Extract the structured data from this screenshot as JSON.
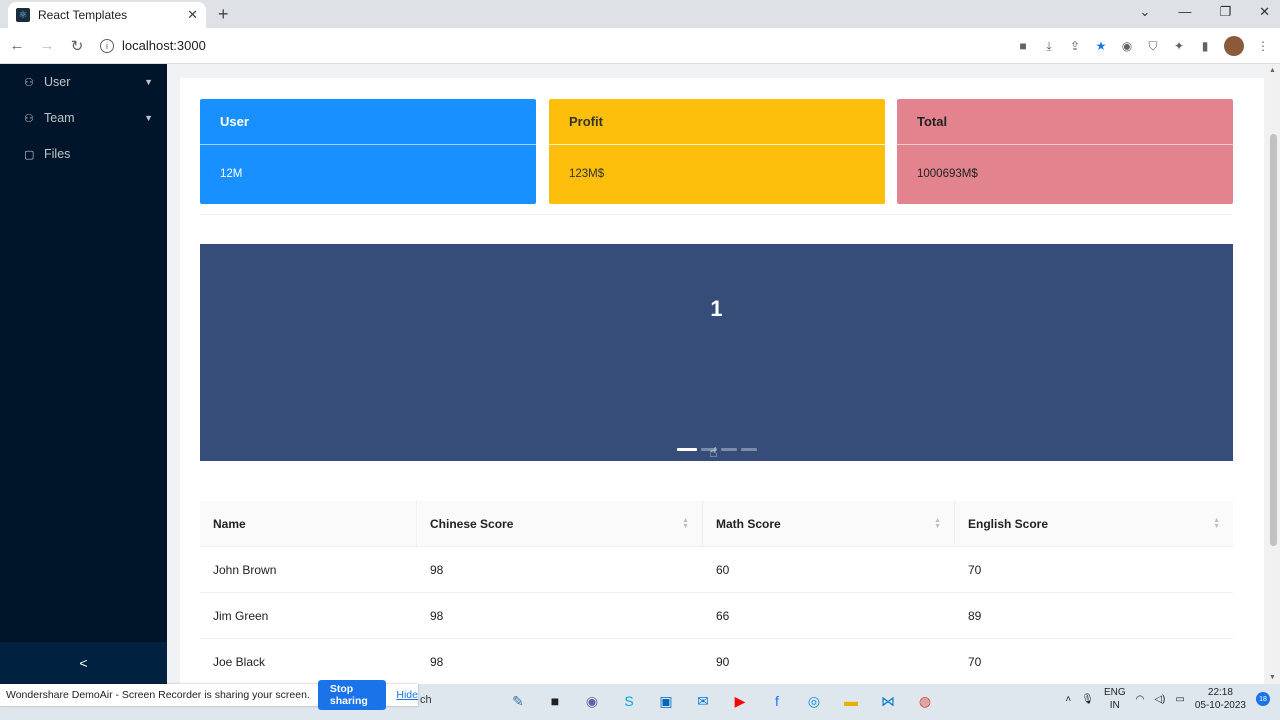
{
  "browser": {
    "tab_title": "React Templates",
    "tab_close": "✕",
    "new_tab": "+",
    "url": "localhost:3000",
    "controls": {
      "back": "←",
      "forward": "→",
      "reload": "↻",
      "minimize": "—",
      "restore": "❐",
      "close": "✕",
      "tab_search": "⌄"
    }
  },
  "sidebar": {
    "items": [
      {
        "icon": "user-icon",
        "glyph": "⚇",
        "label": "User",
        "expandable": true
      },
      {
        "icon": "team-icon",
        "glyph": "⚇",
        "label": "Team",
        "expandable": true
      },
      {
        "icon": "file-icon",
        "glyph": "▢",
        "label": "Files",
        "expandable": false
      }
    ],
    "collapse_glyph": "<"
  },
  "cards": {
    "user": {
      "title": "User",
      "value": "12M",
      "color": "#1890ff"
    },
    "profit": {
      "title": "Profit",
      "value": "123M$",
      "color": "#fdbf0b"
    },
    "total": {
      "title": "Total",
      "value": "1000693M$",
      "color": "#e3838e"
    }
  },
  "carousel": {
    "current_slide": "1",
    "slide_count": 4,
    "active_index": 0,
    "background": "#364d79"
  },
  "table": {
    "columns": [
      {
        "label": "Name",
        "sortable": false
      },
      {
        "label": "Chinese Score",
        "sortable": true
      },
      {
        "label": "Math Score",
        "sortable": true
      },
      {
        "label": "English Score",
        "sortable": true
      }
    ],
    "rows": [
      [
        "John Brown",
        "98",
        "60",
        "70"
      ],
      [
        "Jim Green",
        "98",
        "66",
        "89"
      ],
      [
        "Joe Black",
        "98",
        "90",
        "70"
      ]
    ]
  },
  "screen_share": {
    "message": "Wondershare DemoAir - Screen Recorder is sharing your screen.",
    "stop_label": "Stop sharing",
    "hide_label": "Hide"
  },
  "taskbar": {
    "search_fragment": "ch",
    "language": {
      "line1": "ENG",
      "line2": "IN"
    },
    "time": "22:18",
    "date": "05-10-2023",
    "notification_count": "18"
  }
}
